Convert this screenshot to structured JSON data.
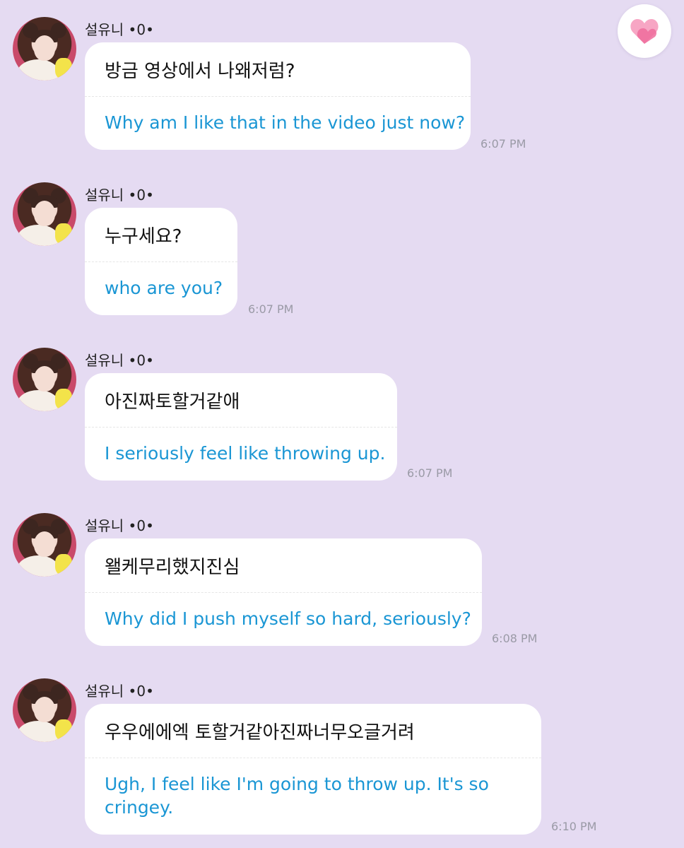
{
  "sender_name": "설유니 •0•",
  "heart_button": {
    "icon": "heart-icon",
    "accent": "#f06fa0"
  },
  "messages": [
    {
      "korean": "방금 영상에서 나왜저럼?",
      "english": "Why am I like that in the video just now?",
      "time": "6:07 PM"
    },
    {
      "korean": "누구세요?",
      "english": "who are you?",
      "time": "6:07 PM"
    },
    {
      "korean": "아진짜토할거같애",
      "english": "I seriously feel like throwing up.",
      "time": "6:07 PM"
    },
    {
      "korean": "왤케무리했지진심",
      "english": "Why did I push myself so hard, seriously?",
      "time": "6:08 PM"
    },
    {
      "korean": "우우에에엑 토할거같아진짜너무오글거려",
      "english": "Ugh, I feel like I'm going to throw up. It's so cringey.",
      "time": "6:10 PM"
    }
  ],
  "colors": {
    "background": "#e5dbf2",
    "bubble": "#ffffff",
    "translation_text": "#1a96d4",
    "timestamp": "#9a9aa6"
  }
}
